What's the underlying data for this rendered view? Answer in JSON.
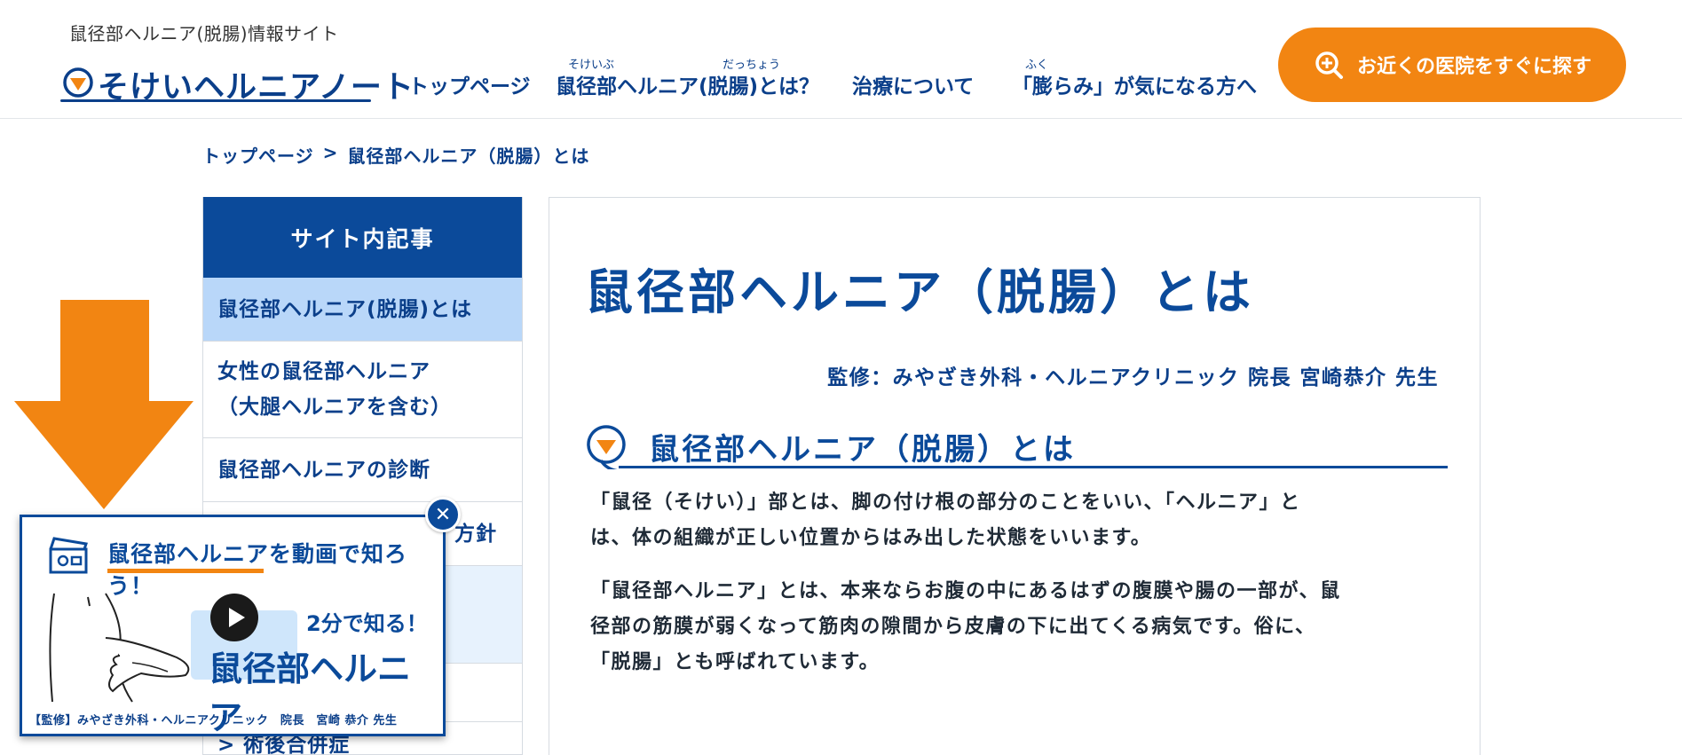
{
  "header": {
    "tagline": "鼠径部ヘルニア(脱腸)情報サイト",
    "logo_text": "そけいヘルニアノート",
    "nav": [
      {
        "label": "トップページ",
        "ruby": ""
      },
      {
        "label": "鼠径部ヘルニア(脱腸)とは？",
        "ruby_a": "そけいぶ",
        "ruby_b": "だっちょう"
      },
      {
        "label": "治療について",
        "ruby": ""
      },
      {
        "label": "「膨らみ」が気になる方へ",
        "ruby": "ふく"
      }
    ],
    "cta_label": "お近くの医院をすぐに探す"
  },
  "breadcrumb": {
    "home": "トップページ",
    "separator": ">",
    "current": "鼠径部ヘルニア（脱腸）とは"
  },
  "sidebar": {
    "title": "サイト内記事",
    "items": [
      {
        "label": "鼠径部ヘルニア(脱腸)とは"
      },
      {
        "label_line1": "女性の鼠径部ヘルニア",
        "label_line2": "（大腿ヘルニアを含む）"
      },
      {
        "label": "鼠径部ヘルニアの診断"
      },
      {
        "label": "方針"
      },
      {
        "label": ""
      },
      {
        "label": ""
      },
      {
        "label": "> 術後合併症"
      }
    ]
  },
  "main": {
    "title": "鼠径部ヘルニア（脱腸）とは",
    "supervisor": "監修：みやざき外科・ヘルニアクリニック 院長 宮崎恭介 先生",
    "section_title": "鼠径部ヘルニア（脱腸）とは",
    "paragraphs": [
      {
        "line1": "「鼠径（そけい）」部とは、脚の付け根の部分のことをいい、「ヘルニア」と",
        "line2": "は、体の組織が正しい位置からはみ出した状態をいいます。"
      },
      {
        "line1": "「鼠径部ヘルニア」とは、本来ならお腹の中にあるはずの腹膜や腸の一部が、鼠",
        "line2": "径部の筋膜が弱くなって筋肉の隙間から皮膚の下に出てくる病気です。俗に、",
        "line3": "「脱腸」とも呼ばれています。"
      }
    ]
  },
  "video_popup": {
    "title": "鼠径部ヘルニアを動画で知ろう！",
    "badge": "2分で知る！",
    "big_text": "鼠径部ヘルニア",
    "footer": "【監修】みやざき外科・ヘルニアクリニック　院長　宮崎 恭介 先生",
    "close_icon": "close-icon"
  },
  "colors": {
    "brand_blue": "#0b4a9a",
    "accent_orange": "#f28512",
    "active_item": "#b9d7f9"
  }
}
